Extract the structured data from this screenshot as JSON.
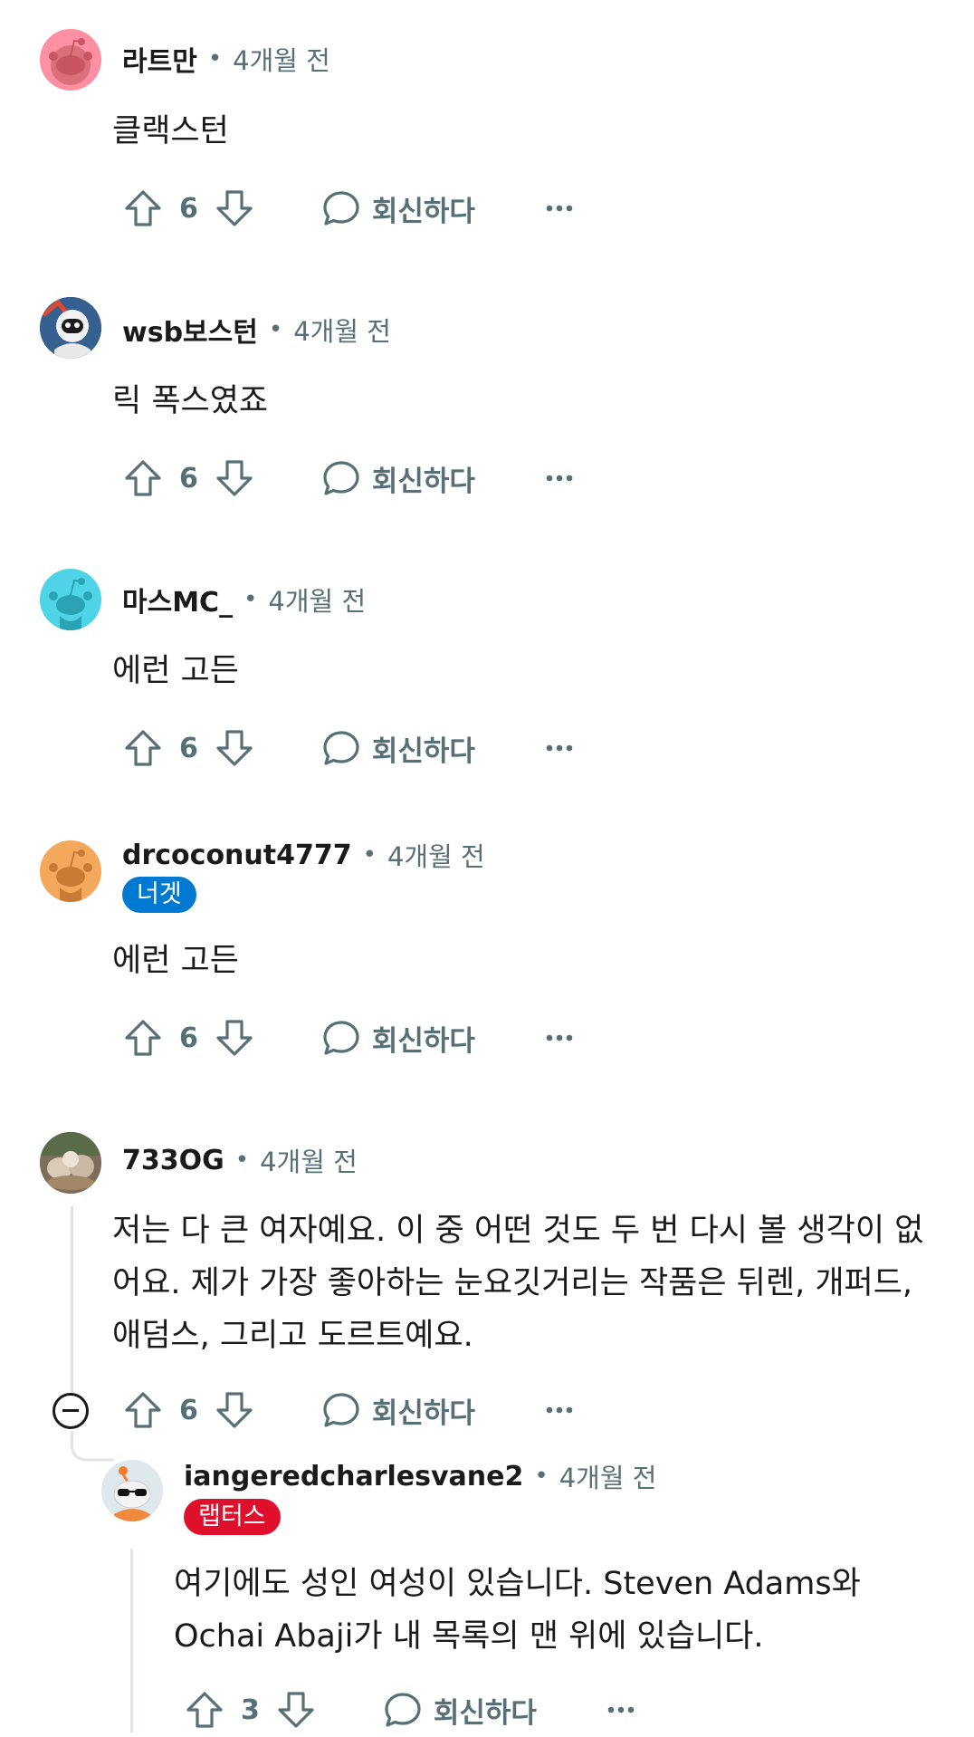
{
  "colors": {
    "meta_gray": "#576f76",
    "nugget_flair": "#0079d3",
    "raptors_flair": "#e0102c",
    "thread_line": "#e1e4e6"
  },
  "comments": [
    {
      "user": "라트만",
      "time": "4개월 전",
      "text": "클랙스턴",
      "score": "6",
      "reply_label": "회신하다",
      "avatar": "reddit-snoo-pink"
    },
    {
      "user": "wsb보스턴",
      "time": "4개월 전",
      "text": "릭 폭스였죠",
      "score": "6",
      "reply_label": "회신하다",
      "avatar": "astronaut-snoo"
    },
    {
      "user": "마스MC_",
      "time": "4개월 전",
      "text": "에런 고든",
      "score": "6",
      "reply_label": "회신하다",
      "avatar": "reddit-snoo-cyan"
    },
    {
      "user": "drcoconut4777",
      "time": "4개월 전",
      "flair": "너겟",
      "text": "에런 고든",
      "score": "6",
      "reply_label": "회신하다",
      "avatar": "reddit-snoo-orange"
    },
    {
      "user": "733OG",
      "time": "4개월 전",
      "text": "저는 다 큰 여자예요. 이 중 어떤 것도 두 번 다시 볼 생각이 없어요. 제가 가장 좋아하는 눈요깃거리는 작품은 뒤렌, 개퍼드, 애덤스, 그리고 도르트예요.",
      "score": "6",
      "reply_label": "회신하다",
      "avatar": "cats-photo"
    },
    {
      "user": "iangeredcharlesvane2",
      "time": "4개월 전",
      "flair": "랩터스",
      "text": "여기에도 성인 여성이 있습니다. Steven Adams와 Ochai Abaji가 내 목록의 맨 위에 있습니다.",
      "score": "3",
      "reply_label": "회신하다",
      "avatar": "sunglasses-snoo"
    }
  ]
}
